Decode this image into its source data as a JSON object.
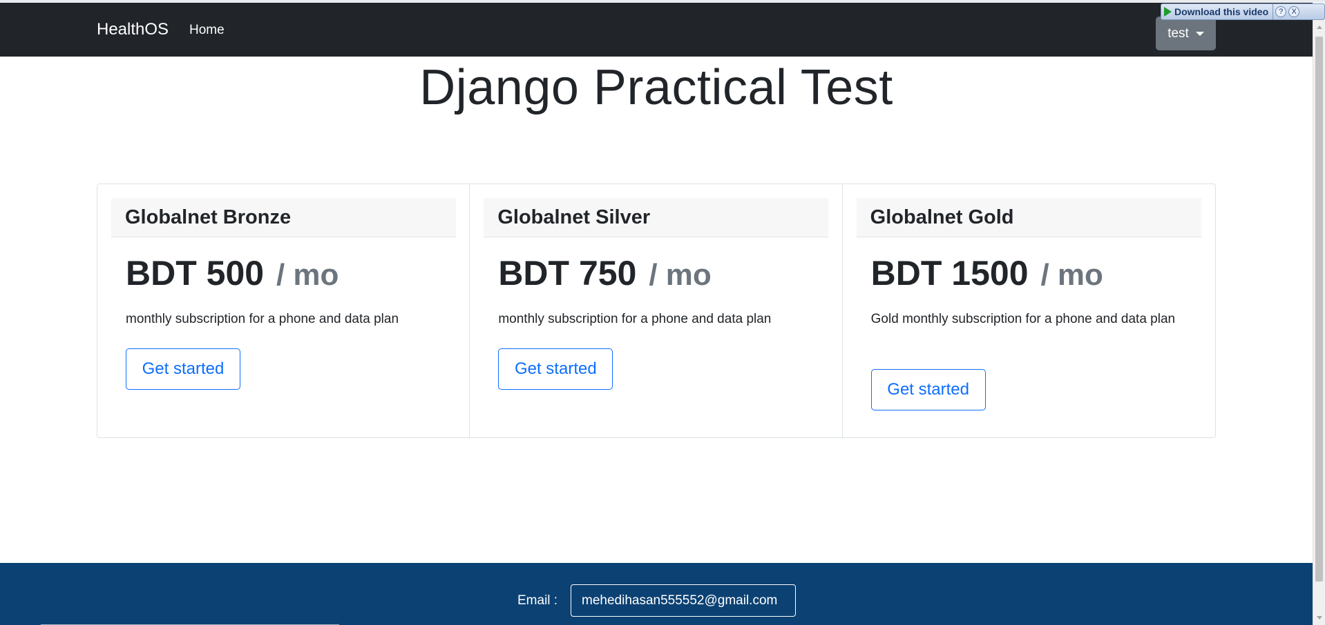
{
  "navbar": {
    "brand": "HealthOS",
    "home_link": "Home",
    "user_menu": "test"
  },
  "download_plugin": {
    "label": "Download this video",
    "help": "?",
    "close": "X"
  },
  "page": {
    "title": "Django Practical Test"
  },
  "plans": [
    {
      "name": "Globalnet Bronze",
      "price": "BDT 500",
      "period": "/ mo",
      "description": "monthly subscription for a phone and data plan",
      "button": "Get started"
    },
    {
      "name": "Globalnet Silver",
      "price": "BDT 750",
      "period": "/ mo",
      "description": "monthly subscription for a phone and data plan",
      "button": "Get started"
    },
    {
      "name": "Globalnet Gold",
      "price": "BDT 1500",
      "period": "/ mo",
      "description": "Gold monthly subscription for a phone and data plan",
      "button": "Get started"
    }
  ],
  "footer": {
    "email_label": "Email :",
    "email_value": "mehedihasan555552@gmail.com"
  },
  "colors": {
    "navbar_bg": "#212529",
    "footer_bg": "#0c4173",
    "primary": "#0d6efd",
    "muted": "#6c757d"
  }
}
